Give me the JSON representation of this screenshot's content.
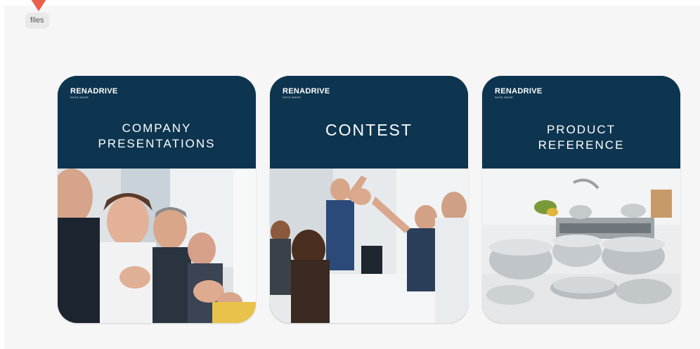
{
  "tooltip": {
    "label": "files"
  },
  "cards": [
    {
      "brand": "RENADRIVE",
      "brand_sub": "DATA WASE",
      "title_line1": "COMPANY",
      "title_line2": "PRESENTATIONS",
      "image": "business-team-applauding-photo"
    },
    {
      "brand": "RENADRIVE",
      "brand_sub": "DATA WASE",
      "title": "CONTEST",
      "image": "team-high-five-photo"
    },
    {
      "brand": "RENADRIVE",
      "brand_sub": "DATA WASE",
      "title_line1": "PRODUCT",
      "title_line2": "REFERENCE",
      "image": "kitchen-cookware-photo"
    }
  ],
  "colors": {
    "card_header": "#0e3550",
    "cursor": "#e8604c",
    "background": "#f6f6f6"
  }
}
